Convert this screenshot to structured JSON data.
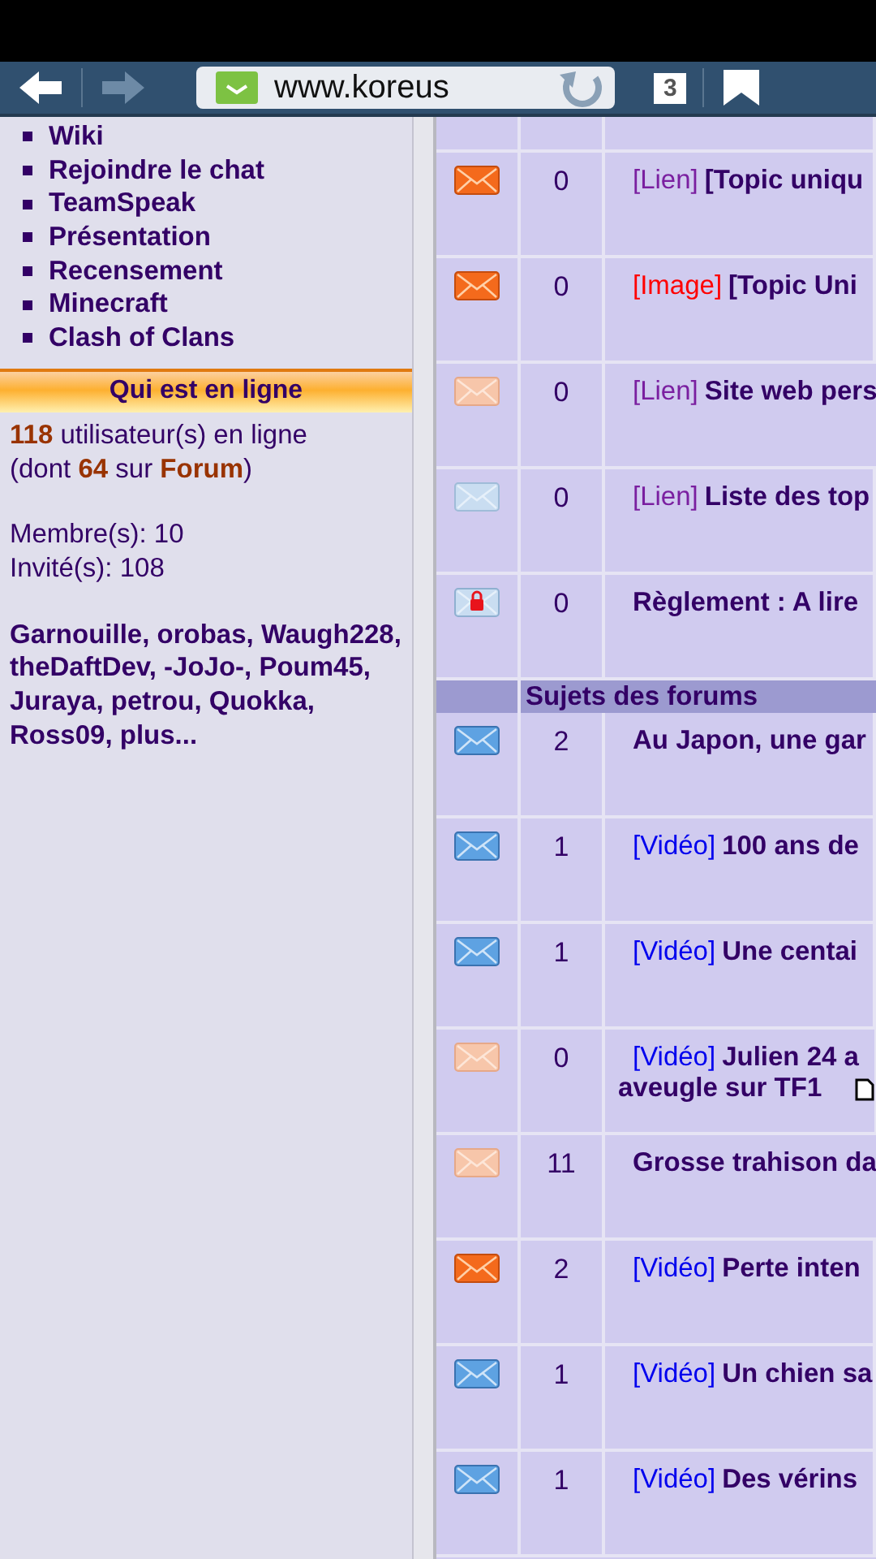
{
  "browser": {
    "url": "www.koreus",
    "tab_count": "3"
  },
  "sidebar": {
    "links": [
      "Wiki",
      "Rejoindre le chat",
      "TeamSpeak",
      "Présentation",
      "Recensement",
      "Minecraft",
      "Clash of Clans"
    ],
    "online": {
      "title": "Qui est en ligne",
      "summary": "**118** utilisateur(s) en ligne",
      "detail": "(dont **64** sur **Forum**)",
      "members": "Membre(s): 10",
      "guests": "Invité(s): 108",
      "names": "Garnouille, orobas, Waugh228, theDaftDev, -JoJo-, Poum45, Juraya, petrou, Quokka, Ross09, plus..."
    }
  },
  "table": {
    "sections": [
      {
        "rows": [
          {
            "kind": "hot",
            "count": "0",
            "tag": {
              "text": "[Lien]",
              "color": "#7a1fa0"
            },
            "title": "[Topic uniqu"
          },
          {
            "kind": "hot",
            "count": "0",
            "tag": {
              "text": "[Image]",
              "color": "#ff0000"
            },
            "title": "[Topic Uni"
          },
          {
            "kind": "hot-read",
            "count": "0",
            "tag": {
              "text": "[Lien]",
              "color": "#7a1fa0"
            },
            "title": "Site web pers"
          },
          {
            "kind": "read",
            "count": "0",
            "tag": {
              "text": "[Lien]",
              "color": "#7a1fa0"
            },
            "title": "Liste des top"
          },
          {
            "kind": "locked",
            "count": "0",
            "title": "Règlement : A lire"
          }
        ]
      },
      {
        "title": "Sujets des forums",
        "rows": [
          {
            "kind": "new",
            "count": "2",
            "title": "Au Japon, une gar"
          },
          {
            "kind": "new",
            "count": "1",
            "tag": {
              "text": "[Vidéo]",
              "color": "#0000ee"
            },
            "title": "100 ans de"
          },
          {
            "kind": "new",
            "count": "1",
            "tag": {
              "text": "[Vidéo]",
              "color": "#0000ee"
            },
            "title": "Une centai"
          },
          {
            "kind": "hot-read",
            "count": "0",
            "tag": {
              "text": "[Vidéo]",
              "color": "#0000ee"
            },
            "title": "Julien 24 a",
            "title_line2": "aveugle sur TF1"
          },
          {
            "kind": "hot-read",
            "count": "11",
            "title": "Grosse trahison da"
          },
          {
            "kind": "hot",
            "count": "2",
            "tag": {
              "text": "[Vidéo]",
              "color": "#0000ee"
            },
            "title": "Perte inten"
          },
          {
            "kind": "new",
            "count": "1",
            "tag": {
              "text": "[Vidéo]",
              "color": "#0000ee"
            },
            "title": "Un chien sa"
          },
          {
            "kind": "new",
            "count": "1",
            "tag": {
              "text": "[Vidéo]",
              "color": "#0000ee"
            },
            "title": "Des vérins"
          }
        ]
      }
    ]
  }
}
